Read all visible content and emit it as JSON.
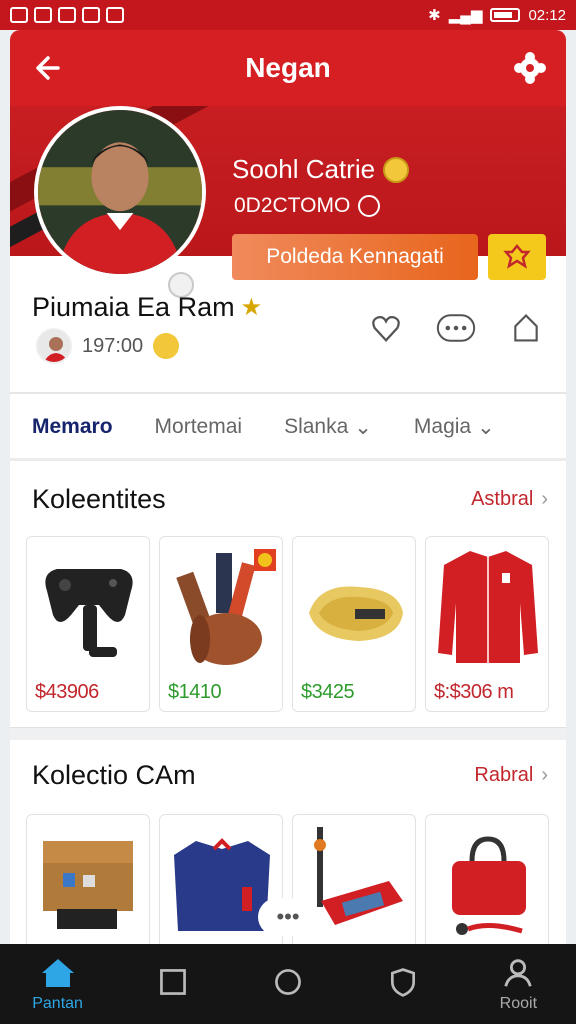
{
  "status_bar": {
    "time": "02:12"
  },
  "header": {
    "title": "Negan"
  },
  "profile": {
    "display_title": "Soohl Catrie",
    "handle": "0D2CTOMO",
    "follow_button": "Poldeda Kennagati",
    "username": "Piumaia Ea Ram",
    "count": "197:00"
  },
  "tabs": [
    {
      "label": "Memaro"
    },
    {
      "label": "Mortemai"
    },
    {
      "label": "Slanka"
    },
    {
      "label": "Magia"
    }
  ],
  "section1": {
    "title": "Koleentites",
    "link": "Astbral",
    "items": [
      {
        "icon": "gamepad-icon",
        "price": "$43906"
      },
      {
        "icon": "leather-roll-icon",
        "price": "$1410"
      },
      {
        "icon": "yellow-belt-icon",
        "price": "$3425"
      },
      {
        "icon": "red-jacket-icon",
        "price": "$:$306 m"
      }
    ]
  },
  "section2": {
    "title": "Kolectio CAm",
    "link": "Rabral",
    "items": [
      {
        "icon": "wooden-box-icon"
      },
      {
        "icon": "blue-jersey-icon"
      },
      {
        "icon": "red-device-icon"
      },
      {
        "icon": "red-bag-icon"
      }
    ],
    "more_label": "•••"
  },
  "bottom_nav": [
    {
      "label": "Pantan",
      "icon": "home-icon"
    },
    {
      "label": "",
      "icon": "square-icon"
    },
    {
      "label": "",
      "icon": "circle-icon"
    },
    {
      "label": "",
      "icon": "shield-icon"
    },
    {
      "label": "Rooit",
      "icon": "profile-icon"
    }
  ],
  "colors": {
    "primary_red": "#d61f22",
    "accent_orange": "#e8651c",
    "active_blue": "#2ea6e6",
    "tab_active": "#16246b"
  }
}
